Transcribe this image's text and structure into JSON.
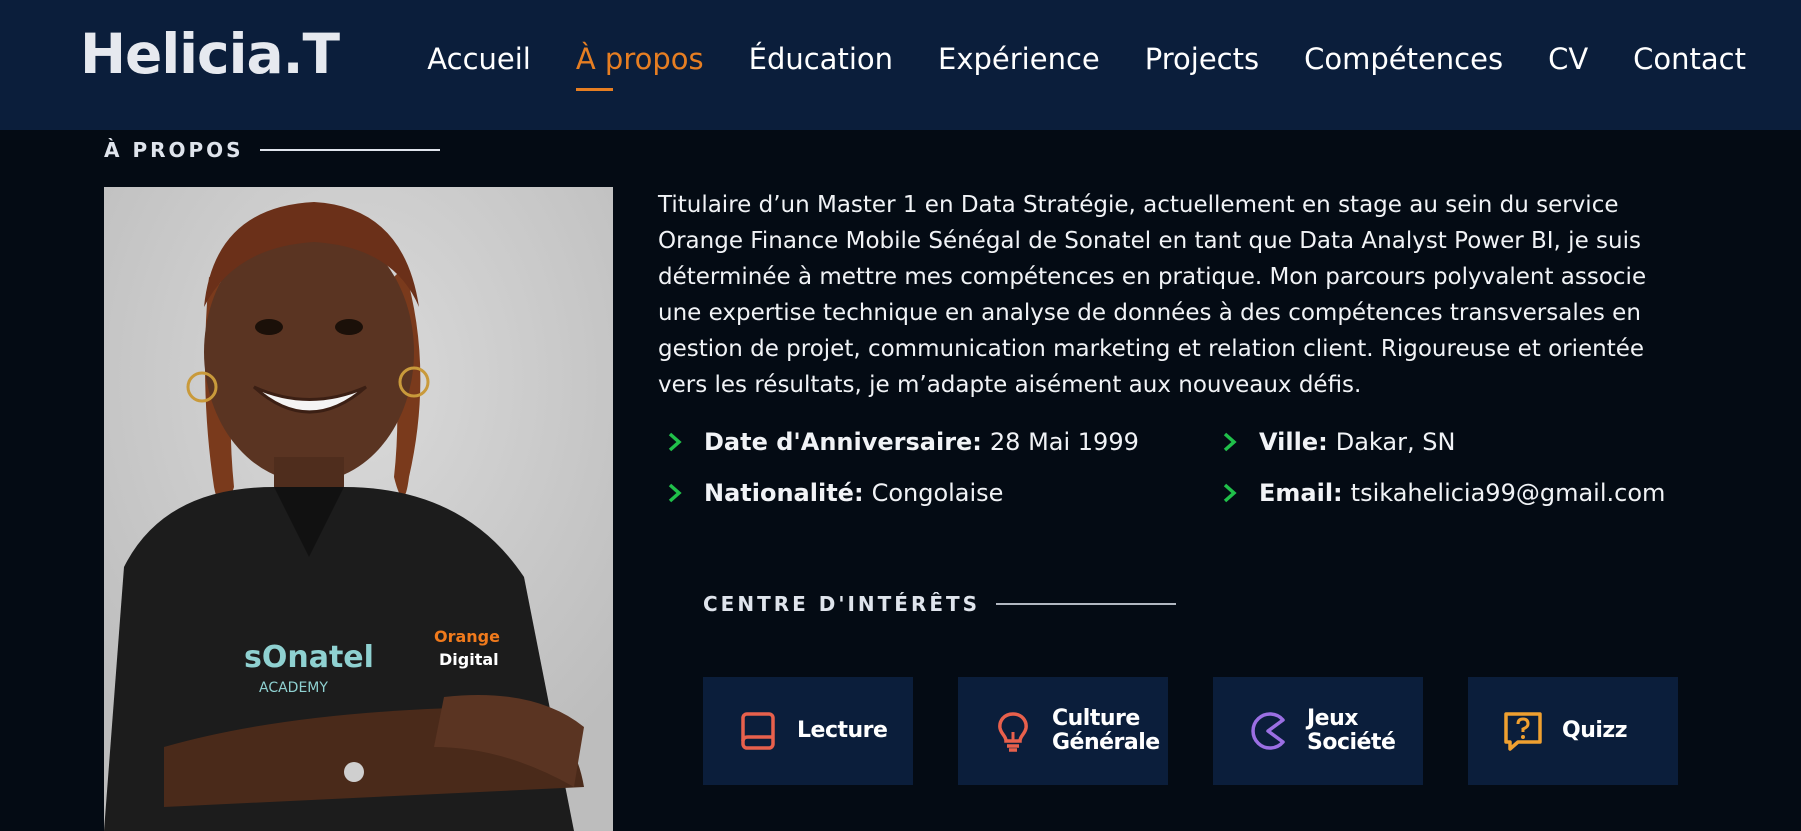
{
  "header": {
    "logo": "Helicia.T",
    "nav": [
      {
        "label": "Accueil",
        "active": false
      },
      {
        "label": "À propos",
        "active": true
      },
      {
        "label": "Éducation",
        "active": false
      },
      {
        "label": "Expérience",
        "active": false
      },
      {
        "label": "Projects",
        "active": false
      },
      {
        "label": "Compétences",
        "active": false
      },
      {
        "label": "CV",
        "active": false
      },
      {
        "label": "Contact",
        "active": false
      }
    ],
    "accent_color": "#e67e22"
  },
  "about": {
    "title": "À PROPOS",
    "bio": "Titulaire d’un Master 1 en Data Stratégie, actuellement en stage au sein du service Orange Finance Mobile Sénégal de Sonatel en tant que Data Analyst Power BI, je suis déterminée à mettre mes compétences en pratique. Mon parcours polyvalent associe une expertise technique en analyse de données à des compétences transversales en gestion de projet, communication marketing et relation client. Rigoureuse et orientée vers les résultats, je m’adapte aisément aux nouveaux défis.",
    "info": {
      "birthday_label": "Date d'Anniversaire:",
      "birthday_value": "28 Mai 1999",
      "city_label": "Ville:",
      "city_value": "Dakar, SN",
      "nationality_label": "Nationalité:",
      "nationality_value": "Congolaise",
      "email_label": "Email:",
      "email_value": "tsikahelicia99@gmail.com"
    },
    "photo_text": {
      "shirt_brand": "sOnatel",
      "shirt_sub": "ACADEMY",
      "badge_top": "Orange",
      "badge_bottom": "Digital"
    }
  },
  "interests": {
    "title": "CENTRE D'INTÉRÊTS",
    "items": [
      {
        "label": "Lecture",
        "icon": "book-icon",
        "color": "#e8604c"
      },
      {
        "label": "Culture\nGénérale",
        "icon": "lightbulb-icon",
        "color": "#e8604c"
      },
      {
        "label": "Jeux\nSociété",
        "icon": "pacman-icon",
        "color": "#9b6fe3"
      },
      {
        "label": "Quizz",
        "icon": "question-chat-icon",
        "color": "#f0a030"
      }
    ]
  },
  "chevron_color": "#20c04a"
}
